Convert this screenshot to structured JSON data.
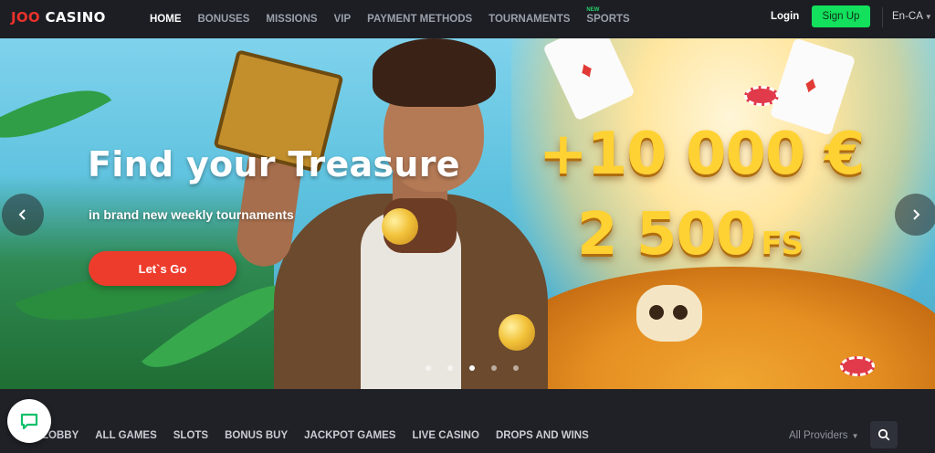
{
  "brand": {
    "logo_part1": "JOO",
    "logo_part2": "CASINO"
  },
  "nav": {
    "items": [
      {
        "label": "HOME",
        "active": true
      },
      {
        "label": "BONUSES"
      },
      {
        "label": "MISSIONS"
      },
      {
        "label": "VIP"
      },
      {
        "label": "PAYMENT METHODS"
      },
      {
        "label": "TOURNAMENTS"
      },
      {
        "label": "SPORTS",
        "badge": "NEW"
      }
    ],
    "login": "Login",
    "signup": "Sign Up",
    "language": "En-CA"
  },
  "hero": {
    "title": "Find your Treasure",
    "subtitle": "in brand new weekly tournaments",
    "cta": "Let`s Go",
    "promo_line1": "+10 000 €",
    "promo_line2_amount": "2 500",
    "promo_line2_unit": "FS",
    "slides_count": 5,
    "active_slide": 3
  },
  "categories": {
    "items": [
      "LOBBY",
      "ALL GAMES",
      "SLOTS",
      "BONUS BUY",
      "JACKPOT GAMES",
      "LIVE CASINO",
      "DROPS AND WINS"
    ],
    "providers": "All Providers"
  },
  "colors": {
    "brand_red": "#e8322b",
    "signup_green": "#13e05c",
    "cta_red": "#ee3c2c",
    "background": "#1f2127"
  },
  "icons": {
    "prev": "chevron-left-icon",
    "next": "chevron-right-icon",
    "search": "search-icon",
    "chat": "chat-icon",
    "providers_caret": "chevron-down-icon",
    "language_caret": "chevron-down-icon"
  }
}
